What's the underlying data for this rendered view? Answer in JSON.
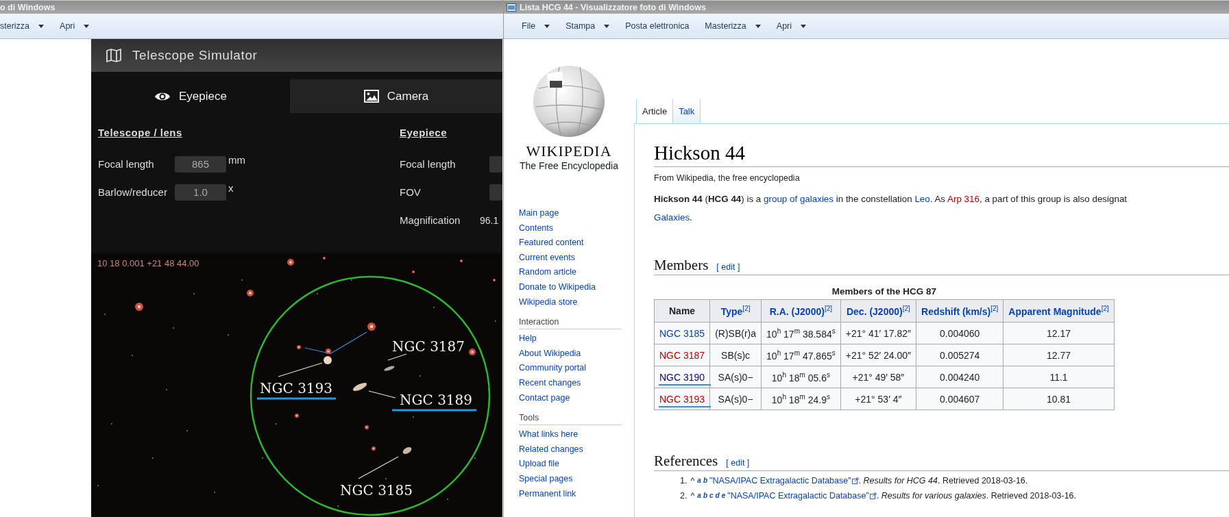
{
  "left_window": {
    "title": "o di Windows",
    "menu": [
      {
        "label": "sterizza",
        "dropdown": true
      },
      {
        "label": "Apri",
        "dropdown": true
      }
    ],
    "app": {
      "title": "Telescope Simulator",
      "tabs": [
        {
          "label": "Eyepiece",
          "selected": true
        },
        {
          "label": "Camera",
          "selected": false
        }
      ],
      "telescope": {
        "heading": "Telescope / lens",
        "fields": [
          {
            "label": "Focal length",
            "value": "865",
            "unit": "mm"
          },
          {
            "label": "Barlow/reducer",
            "value": "1.0",
            "unit": "x"
          }
        ]
      },
      "eyepiece": {
        "heading": "Eyepiece",
        "fields": [
          {
            "label": "Focal length"
          },
          {
            "label": "FOV"
          }
        ],
        "magnification": {
          "label": "Magnification",
          "value": "96.1"
        }
      },
      "sky_view": {
        "coordinates": "10 18 0.001 +21 48 44.00",
        "annotations": [
          {
            "label": "NGC 3187",
            "underlined": false
          },
          {
            "label": "NGC 3193",
            "underlined": true
          },
          {
            "label": "NGC 3189",
            "underlined": true
          },
          {
            "label": "NGC 3185",
            "underlined": false
          }
        ]
      }
    }
  },
  "right_window": {
    "title": "Lista HCG 44 - Visualizzatore foto di Windows",
    "menu": [
      {
        "label": "File",
        "dropdown": true
      },
      {
        "label": "Stampa",
        "dropdown": true
      },
      {
        "label": "Posta elettronica",
        "dropdown": false
      },
      {
        "label": "Masterizza",
        "dropdown": true
      },
      {
        "label": "Apri",
        "dropdown": true
      }
    ],
    "logo": {
      "wordmark": "WIKIPEDIA",
      "tagline": "The Free Encyclopedia"
    },
    "sidebar": [
      {
        "items": [
          "Main page",
          "Contents",
          "Featured content",
          "Current events",
          "Random article",
          "Donate to Wikipedia",
          "Wikipedia store"
        ]
      },
      {
        "heading": "Interaction",
        "items": [
          "Help",
          "About Wikipedia",
          "Community portal",
          "Recent changes",
          "Contact page"
        ]
      },
      {
        "heading": "Tools",
        "items": [
          "What links here",
          "Related changes",
          "Upload file",
          "Special pages",
          "Permanent link"
        ]
      }
    ],
    "tabs": [
      {
        "label": "Article",
        "selected": true
      },
      {
        "label": "Talk",
        "selected": false
      }
    ],
    "article": {
      "title": "Hickson 44",
      "tagline": "From Wikipedia, the free encyclopedia",
      "intro": [
        [
          {
            "kind": "bold",
            "text": "Hickson 44"
          },
          {
            "kind": "plain",
            "text": " ("
          },
          {
            "kind": "bold",
            "text": "HCG 44"
          },
          {
            "kind": "plain",
            "text": ") is a "
          },
          {
            "kind": "link",
            "text": "group of galaxies"
          },
          {
            "kind": "plain",
            "text": " in the constellation "
          },
          {
            "kind": "link",
            "text": "Leo"
          },
          {
            "kind": "plain",
            "text": ". As "
          },
          {
            "kind": "new",
            "text": "Arp 316"
          },
          {
            "kind": "plain",
            "text": ", a part of this group is also designat"
          }
        ],
        [
          {
            "kind": "link",
            "text": "Galaxies"
          },
          {
            "kind": "plain",
            "text": "."
          }
        ]
      ],
      "members": {
        "heading": "Members",
        "edit": "[ edit ]",
        "caption": "Members of the HCG 87",
        "columns": [
          {
            "label": "Name",
            "link": false
          },
          {
            "label": "Type$^{[2]}$",
            "link": true
          },
          {
            "label": "R.A. (J2000)$^{[2]}$",
            "link": true
          },
          {
            "label": "Dec. (J2000)$^{[2]}$",
            "link": true
          },
          {
            "label": "Redshift (km/s)$^{[2]}$",
            "link": true
          },
          {
            "label": "Apparent Magnitude$^{[2]}$",
            "link": true
          }
        ],
        "rows": [
          {
            "kind": "link",
            "underlined": false,
            "cells": [
              "NGC 3185",
              "(R)SB(r)a",
              "10$^{h}$ 17$^{m}$ 38.584$^{s}$",
              "+21° 41′ 17.82″",
              "0.004060",
              "12.17"
            ]
          },
          {
            "kind": "new",
            "underlined": false,
            "cells": [
              "NGC 3187",
              "SB(s)c",
              "10$^{h}$ 17$^{m}$ 47.865$^{s}$",
              "+21° 52′ 24.00″",
              "0.005274",
              "12.77"
            ]
          },
          {
            "kind": "visited",
            "underlined": true,
            "cells": [
              "NGC 3190",
              "SA(s)0−",
              "10$^{h}$ 18$^{m}$ 05.6$^{s}$",
              "+21° 49′ 58″",
              "0.004240",
              "11.1"
            ]
          },
          {
            "kind": "new",
            "underlined": true,
            "cells": [
              "NGC 3193",
              "SA(s)0−",
              "10$^{h}$ 18$^{m}$ 24.9$^{s}$",
              "+21° 53′ 4″",
              "0.004607",
              "10.81"
            ]
          }
        ]
      },
      "references": {
        "heading": "References",
        "edit": "[ edit ]",
        "items": [
          {
            "number": "1.",
            "caret": "^",
            "backlinks": [
              "a",
              "b"
            ],
            "title": "\"NASA/IPAC Extragalactic Database\"",
            "rest": ". *Results for HCG 44*. Retrieved 2018-03-16."
          },
          {
            "number": "2.",
            "caret": "^",
            "backlinks": [
              "a",
              "b",
              "c",
              "d",
              "e"
            ],
            "title": "\"NASA/IPAC Extragalactic Database\"",
            "rest": ". *Results for various galaxies*. Retrieved 2018-03-16."
          }
        ]
      }
    }
  }
}
